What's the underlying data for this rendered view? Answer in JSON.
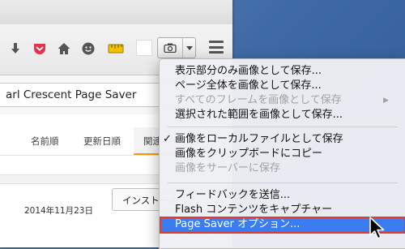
{
  "addon": {
    "name_field": "arl Crescent Page Saver"
  },
  "tabs": [
    {
      "label": "名前順"
    },
    {
      "label": "更新日順"
    },
    {
      "label": "関連"
    }
  ],
  "listing": {
    "date": "2014年11月23日",
    "install_label": "インストール"
  },
  "menu": {
    "items": [
      {
        "label": "表示部分のみ画像として保存..."
      },
      {
        "label": "ページ全体を画像として保存..."
      },
      {
        "label": "すべてのフレームを画像として保存"
      },
      {
        "label": "選択された範囲を画像として保存..."
      },
      {
        "label": "画像をローカルファイルとして保存"
      },
      {
        "label": "画像をクリップボードにコピー"
      },
      {
        "label": "画像をサーバーに保存"
      },
      {
        "label": "フィードバックを送信..."
      },
      {
        "label": "Flash コンテンツをキャプチャー"
      },
      {
        "label": "Page Saver オプション..."
      }
    ],
    "checkmark": "✓",
    "submenu_arrow": "▶"
  },
  "colors": {
    "selection": "#3b7df1",
    "highlight_box": "#e23b2c",
    "accent_tab": "#f39c12"
  }
}
